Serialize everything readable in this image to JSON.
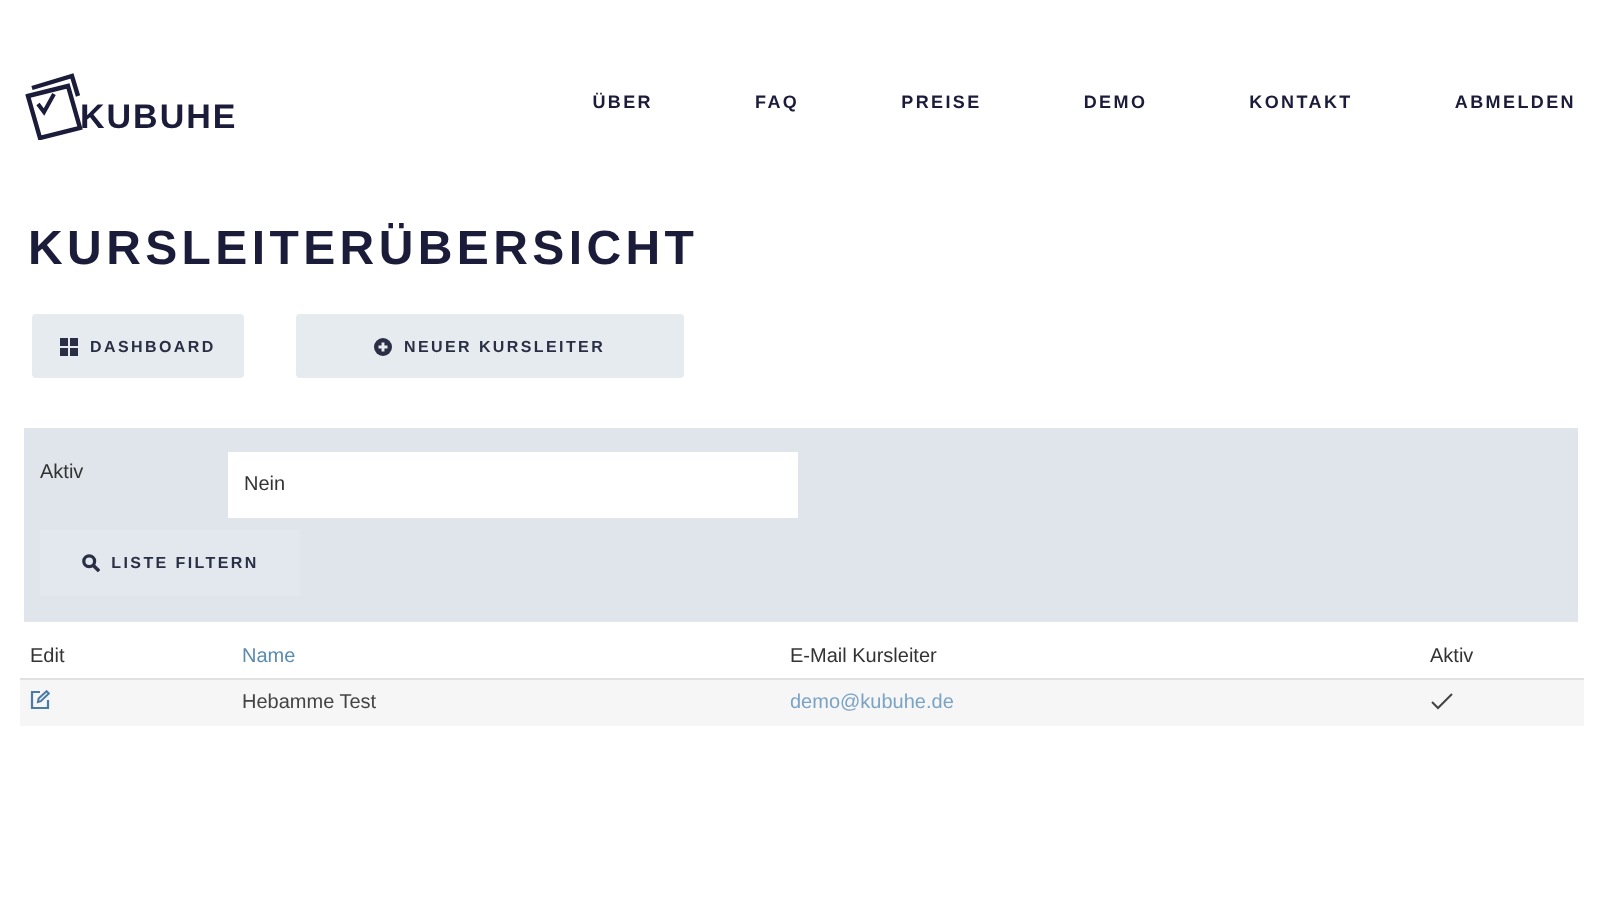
{
  "logo": {
    "text": "KUBUHE"
  },
  "nav": [
    {
      "label": "ÜBER"
    },
    {
      "label": "FAQ"
    },
    {
      "label": "PREISE"
    },
    {
      "label": "DEMO"
    },
    {
      "label": "KONTAKT"
    },
    {
      "label": "ABMELDEN"
    }
  ],
  "title": "KURSLEITERÜBERSICHT",
  "actions": [
    {
      "label": "DASHBOARD",
      "kind": "dashboard"
    },
    {
      "label": "NEUER KURSLEITER",
      "kind": "add"
    }
  ],
  "filter": {
    "label": "Aktiv",
    "value": "Nein",
    "button": "LISTE FILTERN"
  },
  "table": {
    "columns": [
      {
        "label": "Edit",
        "sortable": false
      },
      {
        "label": "Name",
        "sortable": true
      },
      {
        "label": "E-Mail Kursleiter",
        "sortable": false
      },
      {
        "label": "Aktiv",
        "sortable": false
      }
    ],
    "rows": [
      {
        "name": "Hebamme Test",
        "email": "demo@kubuhe.de",
        "aktiv": true
      }
    ]
  }
}
